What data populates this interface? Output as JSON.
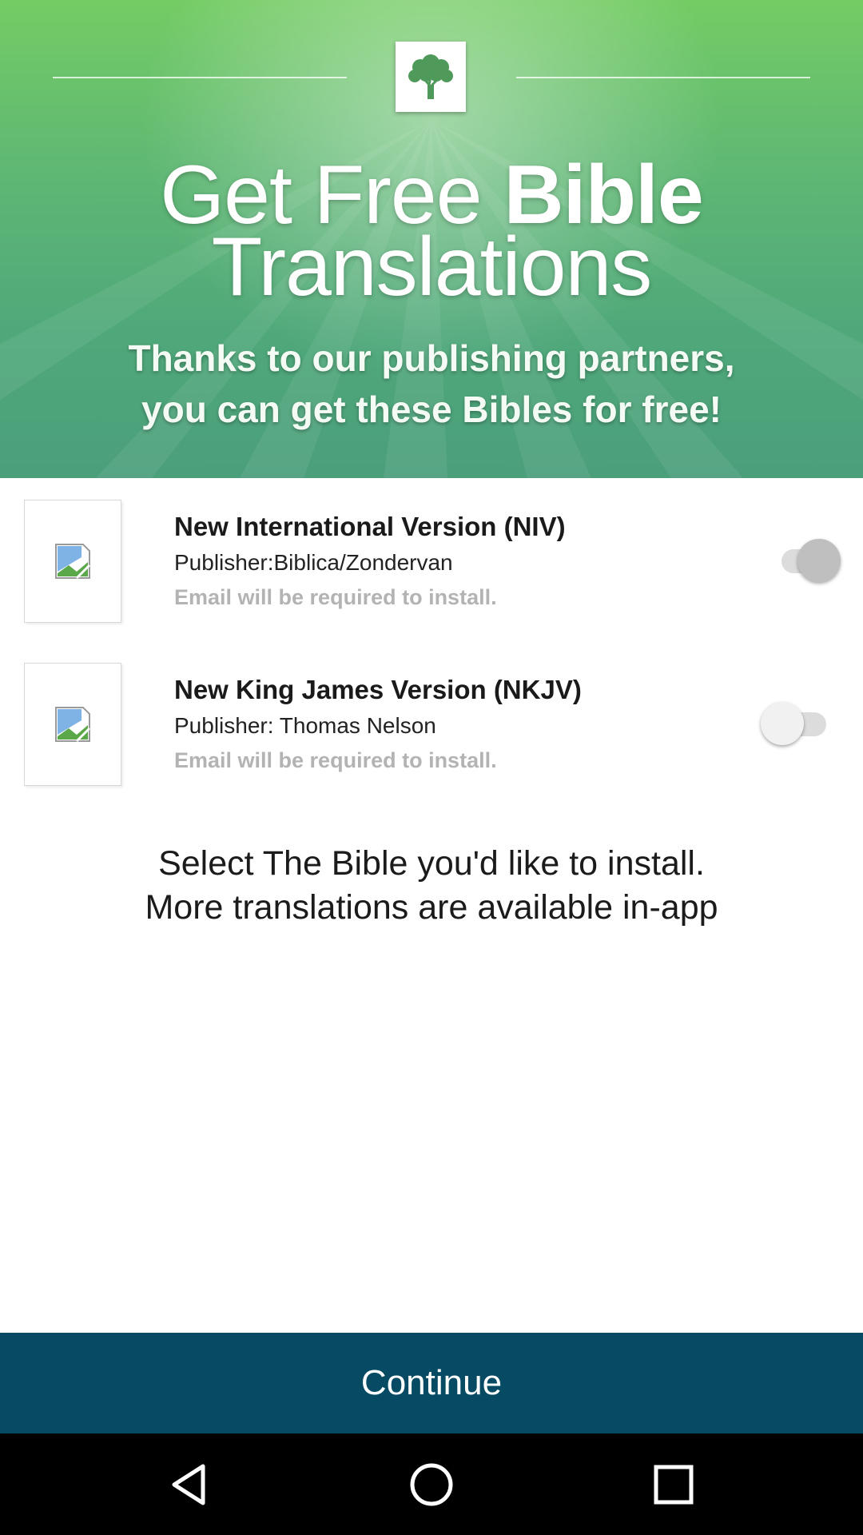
{
  "banner": {
    "title_line1_regular": "Get Free ",
    "title_line1_bold": "Bible",
    "title_line2": "Translations",
    "subtitle_line1": "Thanks to our publishing partners,",
    "subtitle_line2": "you can get these Bibles for free!",
    "logo_icon": "tree-logo-icon",
    "colors": {
      "top": "#74cc64",
      "bottom": "#4b9f7b"
    }
  },
  "bibles": [
    {
      "title": "New International Version (NIV)",
      "publisher": "Publisher:Biblica/Zondervan",
      "note": "Email will be required to install.",
      "toggle_on": true,
      "thumbnail_icon": "broken-image-icon"
    },
    {
      "title": "New King James Version (NKJV)",
      "publisher": "Publisher: Thomas Nelson",
      "note": "Email will be required to install.",
      "toggle_on": false,
      "thumbnail_icon": "broken-image-icon"
    }
  ],
  "instructions": {
    "line1": "Select The Bible you'd like to install.",
    "line2": "More translations are available in-app"
  },
  "continue": {
    "label": "Continue",
    "color": "#064a63"
  },
  "navbar": {
    "back_icon": "back-triangle-icon",
    "home_icon": "home-circle-icon",
    "recents_icon": "recents-square-icon"
  }
}
